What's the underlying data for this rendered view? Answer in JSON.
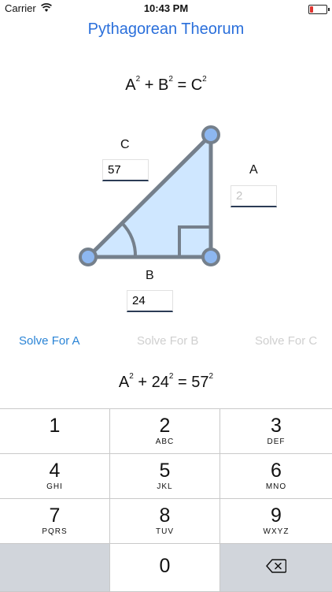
{
  "status": {
    "carrier": "Carrier",
    "time": "10:43 PM"
  },
  "title": "Pythagorean Theorum",
  "formula": {
    "a": "A",
    "b": "B",
    "c": "C",
    "exp": "2",
    "plus": "+",
    "eq": "="
  },
  "labels": {
    "a": "A",
    "b": "B",
    "c": "C"
  },
  "inputs": {
    "c_value": "57",
    "a_placeholder": "2",
    "b_value": "24"
  },
  "solve": {
    "a": "Solve For A",
    "b": "Solve For B",
    "c": "Solve For C",
    "active": "a"
  },
  "equation": {
    "a": "A",
    "b": "24",
    "c": "57",
    "exp": "2",
    "plus": "+",
    "eq": "="
  },
  "colors": {
    "accent": "#2a84d6",
    "title": "#2a6fdb",
    "triangle_fill": "#cfe7ff",
    "triangle_stroke": "#75808c",
    "vertex_fill": "#8db7f0"
  },
  "keypad": [
    {
      "num": "1",
      "sub": ""
    },
    {
      "num": "2",
      "sub": "ABC"
    },
    {
      "num": "3",
      "sub": "DEF"
    },
    {
      "num": "4",
      "sub": "GHI"
    },
    {
      "num": "5",
      "sub": "JKL"
    },
    {
      "num": "6",
      "sub": "MNO"
    },
    {
      "num": "7",
      "sub": "PQRS"
    },
    {
      "num": "8",
      "sub": "TUV"
    },
    {
      "num": "9",
      "sub": "WXYZ"
    },
    {
      "num": "0",
      "sub": ""
    }
  ],
  "delete_icon": "backspace-icon"
}
